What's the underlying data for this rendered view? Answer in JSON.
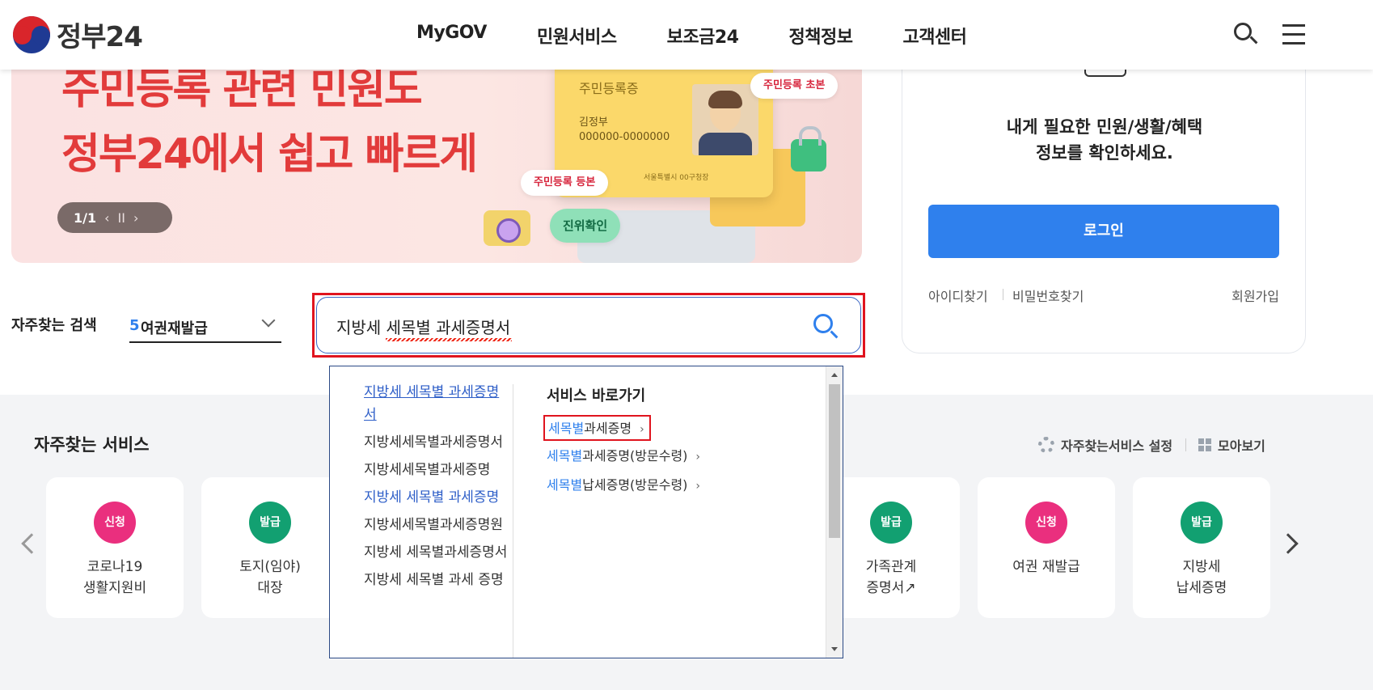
{
  "header": {
    "logo_text": "정부24",
    "nav": [
      "MyGOV",
      "민원서비스",
      "보조금24",
      "정책정보",
      "고객센터"
    ],
    "search_icon": "search-icon",
    "menu_icon": "hamburger-menu-icon"
  },
  "banner": {
    "line1": "주민등록 관련 민원도",
    "line2": "정부24에서 쉽고 빠르게",
    "card_title": "주민등록증",
    "card_name": "김정부",
    "card_number": "000000-0000000",
    "card_issuer": "서울특별시 00구청장",
    "pill1": "주민등록 초본",
    "pill2": "주민등록 등본",
    "pill3": "진위확인",
    "pager": "1/1",
    "prev": "‹",
    "pause": "II",
    "next": "›"
  },
  "login": {
    "message1": "내게 필요한 민원/생활/혜택",
    "message2": "정보를 확인하세요.",
    "button": "로그인",
    "find_id": "아이디찾기",
    "find_pw": "비밀번호찾기",
    "signup": "회원가입"
  },
  "frequent_search": {
    "label": "자주찾는 검색",
    "rank": "5",
    "term": "여권재발급"
  },
  "search": {
    "value": "지방세 세목별 과세증명서"
  },
  "dropdown": {
    "suggestions": [
      {
        "text": "지방세 세목별 과세증명서",
        "style": "hl ul"
      },
      {
        "text": "지방세세목별과세증명서",
        "style": ""
      },
      {
        "text": "지방세세목별과세증명",
        "style": ""
      },
      {
        "text": "지방세 세목별 과세증명",
        "style": "hl"
      },
      {
        "text": "지방세세목별과세증명원",
        "style": ""
      },
      {
        "text": "지방세 세목별과세증명서",
        "style": ""
      },
      {
        "text": "지방세 세목별 과세 증명",
        "style": ""
      }
    ],
    "shortcut_header": "서비스 바로가기",
    "shortcuts": [
      {
        "keyword": "세목별",
        "rest": "과세증명"
      },
      {
        "keyword": "세목별",
        "rest": "과세증명(방문수령)"
      },
      {
        "keyword": "세목별",
        "rest": "납세증명(방문수령)"
      }
    ],
    "arrow": "›"
  },
  "services": {
    "title": "자주찾는 서비스",
    "settings": "자주찾는서비스 설정",
    "view_all": "모아보기",
    "cards": [
      {
        "badge": "신청",
        "type": "apply",
        "name": "코로나19\n생활지원비"
      },
      {
        "badge": "발급",
        "type": "issue",
        "name": "토지(임야)\n대장"
      },
      {
        "badge": "발급",
        "type": "issue",
        "name": "가족관계\n증명서↗"
      },
      {
        "badge": "신청",
        "type": "apply",
        "name": "여권 재발급"
      },
      {
        "badge": "발급",
        "type": "issue",
        "name": "지방세\n납세증명"
      }
    ]
  },
  "colors": {
    "accent_blue": "#2f80ed",
    "highlight_red": "#e0141e",
    "apply_pink": "#ea2f7e",
    "issue_green": "#12a071"
  }
}
